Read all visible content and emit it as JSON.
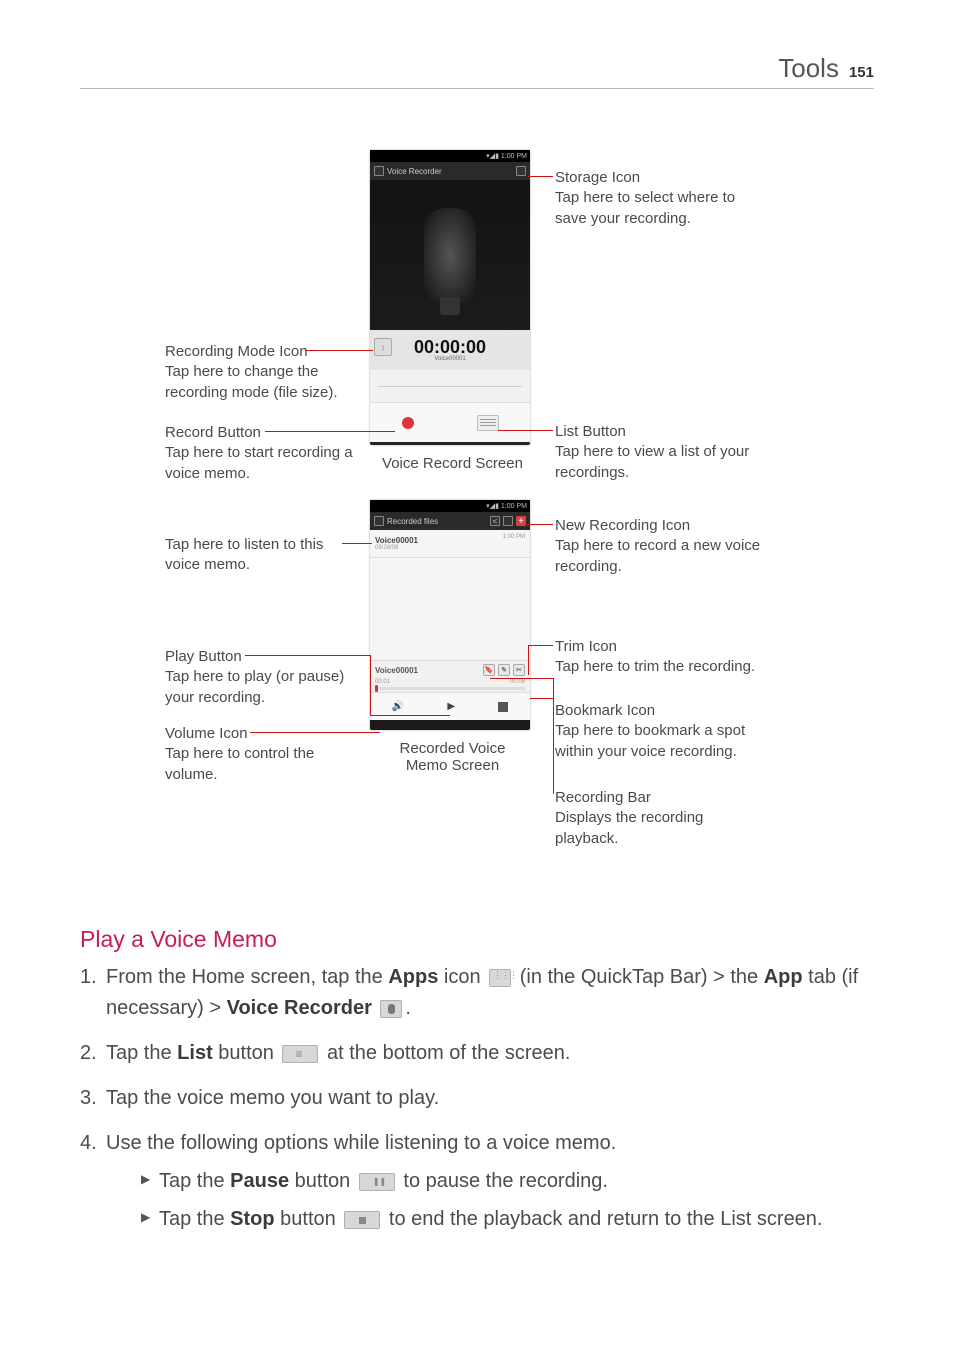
{
  "header": {
    "section": "Tools",
    "page": "151"
  },
  "screen1": {
    "statusTime": "1:00 PM",
    "title": "Voice Recorder",
    "timer": "00:00:00",
    "timerSub": "Voice00001",
    "caption": "Voice Record Screen"
  },
  "screen2": {
    "statusTime": "1:00 PM",
    "title": "Recorded files",
    "file": {
      "name": "Voice00001",
      "date": "08/28/08",
      "time": "1:00 PM"
    },
    "playbackName": "Voice00001",
    "playbackTime": "00:01",
    "caption": "Recorded Voice\nMemo Screen"
  },
  "callouts": {
    "storageTitle": "Storage Icon",
    "storageDesc": "Tap here to select where to save your recording.",
    "modeTitle": "Recording Mode Icon",
    "modeDesc": "Tap here to change the recording mode (file size).",
    "recordTitle": "Record Button",
    "recordDesc": "Tap here to start recording a voice memo.",
    "listTitle": "List Button",
    "listDesc": "Tap here to view a list of your recordings.",
    "listenDesc": "Tap here to listen to this voice memo.",
    "newRecTitle": "New Recording Icon",
    "newRecDesc": "Tap here to record a new voice recording.",
    "playTitle": "Play Button",
    "playDesc": "Tap here to play (or pause) your recording.",
    "trimTitle": "Trim Icon",
    "trimDesc": "Tap here to trim the recording.",
    "bookmarkTitle": "Bookmark Icon",
    "bookmarkDesc": "Tap here to bookmark a spot within your voice recording.",
    "volumeTitle": "Volume Icon",
    "volumeDesc": "Tap here to control the volume.",
    "recBarTitle": "Recording Bar",
    "recBarDesc": "Displays the recording playback."
  },
  "section_heading": "Play a Voice Memo",
  "steps": {
    "s1_a": "From the Home screen, tap the ",
    "s1_apps": "Apps",
    "s1_b": " icon ",
    "s1_c": " (in the QuickTap Bar) > the ",
    "s1_app": "App",
    "s1_d": " tab (if necessary) > ",
    "s1_vr": "Voice Recorder",
    "s1_e": " .",
    "s2_a": "Tap the ",
    "s2_list": "List",
    "s2_b": " button ",
    "s2_c": " at the bottom of the screen.",
    "s3": "Tap the voice memo you want to play.",
    "s4": "Use the following options while listening to a voice memo.",
    "b1_a": "Tap the ",
    "b1_pause": "Pause",
    "b1_b": " button ",
    "b1_c": " to pause the recording.",
    "b2_a": "Tap the ",
    "b2_stop": "Stop",
    "b2_b": " button ",
    "b2_c": " to end the playback and return to the List screen."
  }
}
